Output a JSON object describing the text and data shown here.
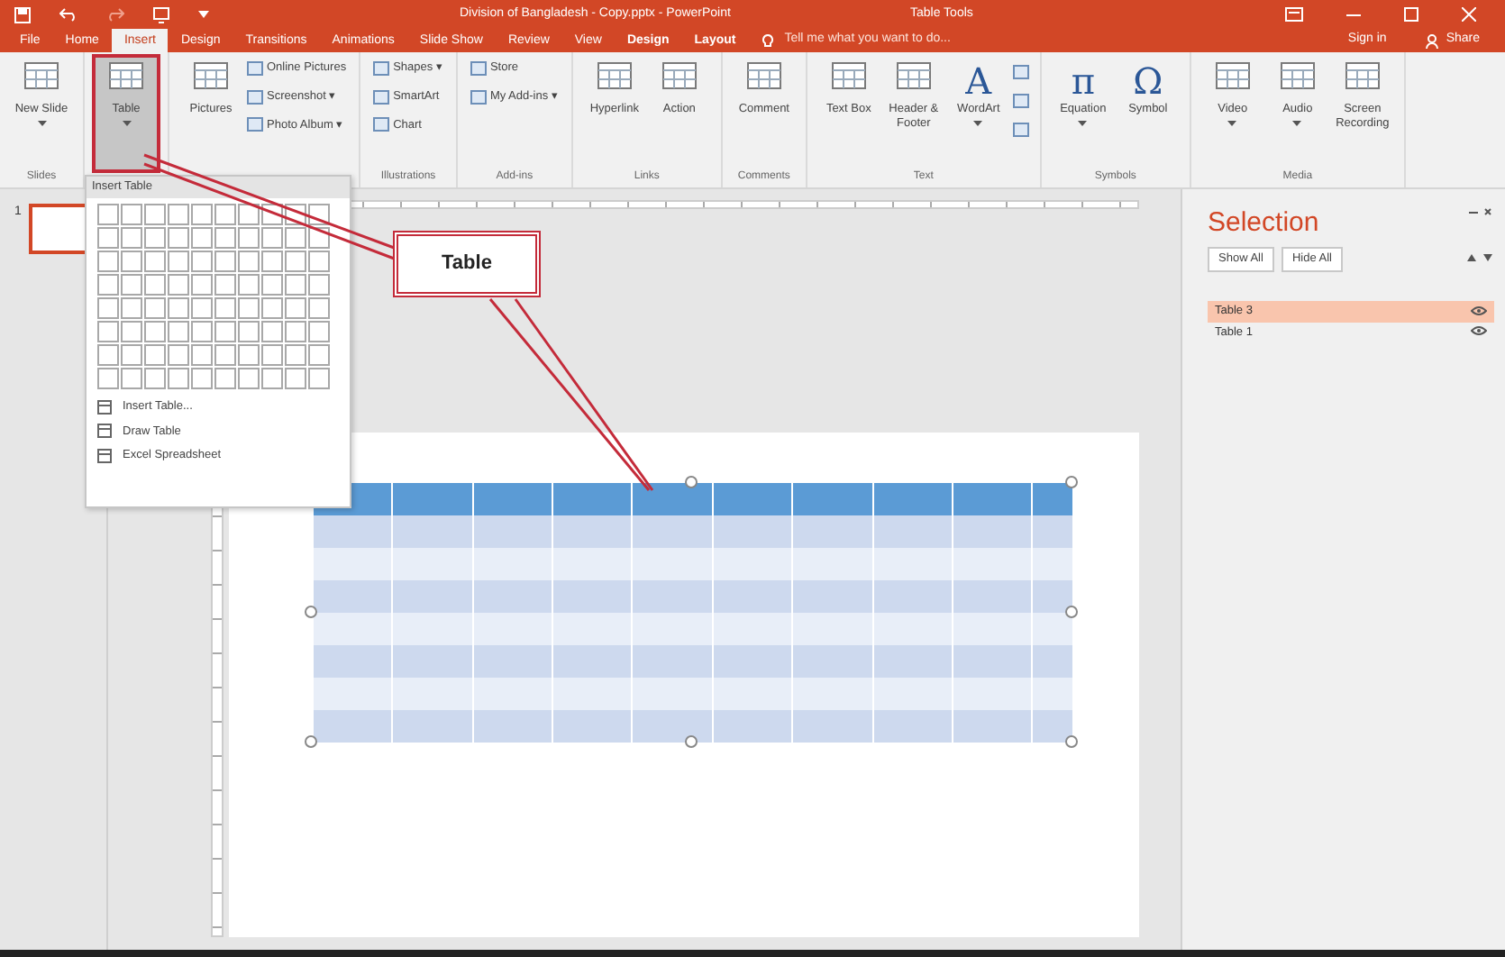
{
  "window": {
    "title": "Division of Bangladesh - Copy.pptx - PowerPoint",
    "context_title": "Table Tools"
  },
  "tabs": [
    {
      "label": "File",
      "selected": false,
      "context": false
    },
    {
      "label": "Home",
      "selected": false,
      "context": false
    },
    {
      "label": "Insert",
      "selected": true,
      "context": false
    },
    {
      "label": "Design",
      "selected": false,
      "context": false
    },
    {
      "label": "Transitions",
      "selected": false,
      "context": false
    },
    {
      "label": "Animations",
      "selected": false,
      "context": false
    },
    {
      "label": "Slide Show",
      "selected": false,
      "context": false
    },
    {
      "label": "Review",
      "selected": false,
      "context": false
    },
    {
      "label": "View",
      "selected": false,
      "context": false
    },
    {
      "label": "Design",
      "selected": false,
      "context": true
    },
    {
      "label": "Layout",
      "selected": false,
      "context": true
    }
  ],
  "tell_me": {
    "placeholder": "Tell me what you want to do..."
  },
  "sign_in": "Sign in",
  "share": "Share",
  "ribbon": [
    {
      "label": "Slides",
      "items": [
        {
          "kind": "large",
          "label": "New Slide",
          "dropdown": true,
          "selected": false
        }
      ]
    },
    {
      "items": [
        {
          "kind": "large",
          "label": "Table",
          "dropdown": true,
          "selected": true
        }
      ]
    },
    {
      "items": [
        {
          "kind": "large",
          "label": "Pictures",
          "dropdown": false,
          "selected": false
        },
        {
          "kind": "stack",
          "buttons": [
            {
              "label": "Online Pictures"
            },
            {
              "label": "Screenshot ▾"
            },
            {
              "label": "Photo Album ▾"
            }
          ]
        }
      ]
    },
    {
      "label": "Illustrations",
      "items": [
        {
          "kind": "stack",
          "buttons": [
            {
              "label": "Shapes ▾"
            },
            {
              "label": "SmartArt"
            },
            {
              "label": "Chart"
            }
          ]
        }
      ]
    },
    {
      "label": "Add-ins",
      "items": [
        {
          "kind": "stack",
          "buttons": [
            {
              "label": "Store"
            },
            {
              "label": "My Add-ins ▾"
            }
          ]
        }
      ]
    },
    {
      "label": "Links",
      "items": [
        {
          "kind": "large",
          "label": "Hyperlink",
          "dropdown": false,
          "selected": false
        },
        {
          "kind": "large",
          "label": "Action",
          "dropdown": false,
          "selected": false
        }
      ]
    },
    {
      "label": "Comments",
      "items": [
        {
          "kind": "large",
          "label": "Comment",
          "dropdown": false,
          "selected": false
        }
      ]
    },
    {
      "label": "Text",
      "items": [
        {
          "kind": "large",
          "label": "Text Box",
          "dropdown": false,
          "selected": false
        },
        {
          "kind": "large",
          "label": "Header & Footer",
          "dropdown": false,
          "selected": false
        },
        {
          "kind": "large",
          "label": "WordArt",
          "glyph": "A",
          "dropdown": true,
          "selected": false
        },
        {
          "kind": "icons"
        }
      ]
    },
    {
      "label": "Symbols",
      "items": [
        {
          "kind": "large",
          "label": "Equation",
          "glyph": "π",
          "dropdown": true,
          "selected": false
        },
        {
          "kind": "large",
          "label": "Symbol",
          "glyph": "Ω",
          "dropdown": false,
          "selected": false
        }
      ]
    },
    {
      "label": "Media",
      "items": [
        {
          "kind": "large",
          "label": "Video",
          "dropdown": true,
          "selected": false
        },
        {
          "kind": "large",
          "label": "Audio",
          "dropdown": true,
          "selected": false
        },
        {
          "kind": "large",
          "label": "Screen Recording",
          "dropdown": false,
          "selected": false
        }
      ]
    }
  ],
  "insert_table_menu": {
    "title": "Insert Table",
    "items": [
      {
        "label": "Insert Table..."
      },
      {
        "label": "Draw Table"
      },
      {
        "label": "Excel Spreadsheet"
      }
    ]
  },
  "callout": {
    "text": "Table"
  },
  "thumbnails": [
    {
      "number": "1",
      "selected": true
    }
  ],
  "slide": {
    "table": {
      "rows": [
        {
          "kind": "header"
        },
        {
          "kind": "band"
        },
        {
          "kind": "plain"
        },
        {
          "kind": "band"
        },
        {
          "kind": "plain"
        },
        {
          "kind": "band"
        },
        {
          "kind": "plain"
        },
        {
          "kind": "band"
        }
      ]
    }
  },
  "selection_pane": {
    "title": "Selection",
    "buttons": [
      "Show All",
      "Hide All"
    ],
    "items": [
      {
        "label": "Table 3",
        "selected": true
      },
      {
        "label": "Table 1",
        "selected": false
      }
    ]
  }
}
